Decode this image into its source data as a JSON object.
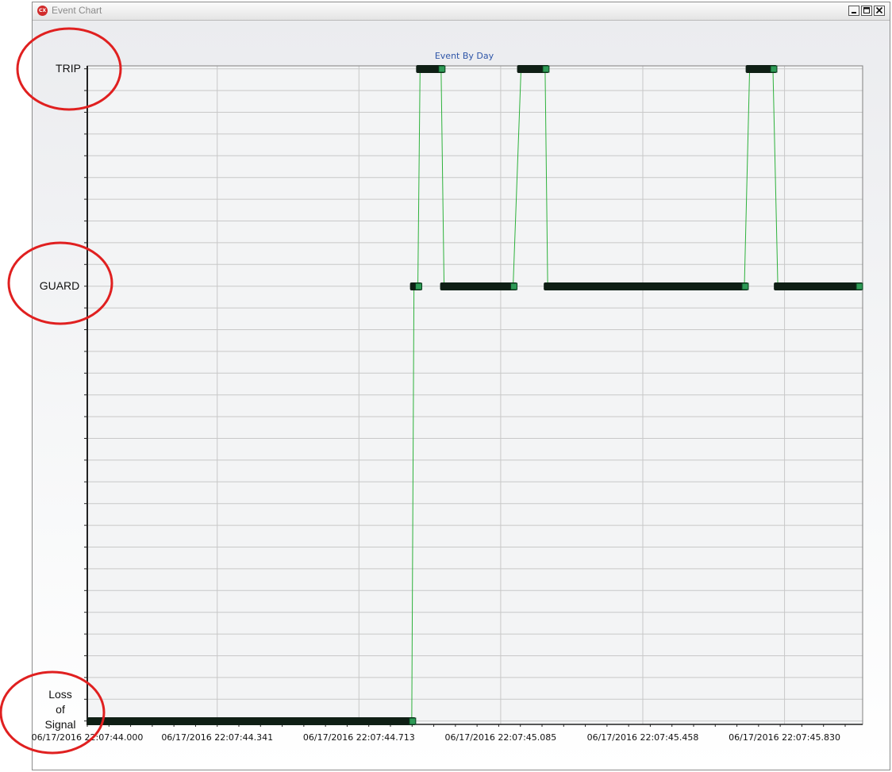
{
  "window": {
    "title": "Event Chart",
    "icon": "app-logo-icon",
    "controls": [
      "minimize-icon",
      "maximize-icon",
      "close-icon"
    ]
  },
  "chart_data": {
    "type": "line",
    "title": "Event By Day",
    "states": [
      "TRIP",
      "GUARD",
      "Loss\nof\nSignal"
    ],
    "x_tick_labels": [
      "06/17/2016 22:07:44.000",
      "06/17/2016 22:07:44.341",
      "06/17/2016 22:07:44.713",
      "06/17/2016 22:07:45.085",
      "06/17/2016 22:07:45.458",
      "06/17/2016 22:07:45.830"
    ],
    "x_ticks_seconds": [
      44.0,
      44.341,
      44.713,
      45.085,
      45.458,
      45.83
    ],
    "xlim_seconds": [
      44.0,
      46.035
    ],
    "grid": true,
    "events": [
      {
        "state": "Loss\nof\nSignal",
        "start": 44.0,
        "end": 44.862
      },
      {
        "state": "GUARD",
        "start": 44.847,
        "end": 44.878
      },
      {
        "state": "TRIP",
        "start": 44.863,
        "end": 44.939
      },
      {
        "state": "GUARD",
        "start": 44.926,
        "end": 45.128
      },
      {
        "state": "TRIP",
        "start": 45.128,
        "end": 45.212
      },
      {
        "state": "GUARD",
        "start": 45.198,
        "end": 45.735
      },
      {
        "state": "TRIP",
        "start": 45.728,
        "end": 45.81
      },
      {
        "state": "GUARD",
        "start": 45.802,
        "end": 46.035
      }
    ],
    "colors": {
      "bar": "#0f1f15",
      "end_marker": "#2e9a56",
      "transition": "#2db13b",
      "grid": "#c8c8c8",
      "title": "#2e55a8"
    }
  },
  "annotations": [
    {
      "type": "circle",
      "label": "TRIP",
      "color": "#e02020"
    },
    {
      "type": "circle",
      "label": "GUARD",
      "color": "#e02020"
    },
    {
      "type": "circle",
      "label": "Loss of Signal",
      "color": "#e02020"
    }
  ]
}
